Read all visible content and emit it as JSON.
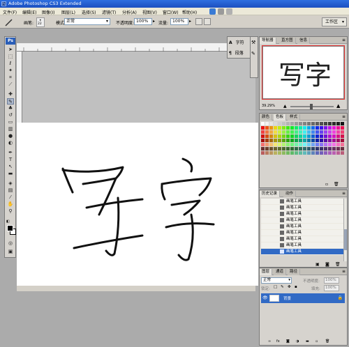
{
  "window": {
    "title": "Adobe Photoshop CS3 Extended",
    "app_icon": "Ps"
  },
  "menu": [
    "文件(F)",
    "编辑(E)",
    "图像(I)",
    "图层(L)",
    "选择(S)",
    "滤镜(T)",
    "分析(A)",
    "视图(V)",
    "窗口(W)",
    "帮助(H)"
  ],
  "options_bar": {
    "brush_label": "画笔:",
    "brush_size": "22",
    "mode_label": "模式:",
    "mode_value": "正常",
    "opacity_label": "不透明度:",
    "opacity_value": "100%",
    "flow_label": "流量:",
    "flow_value": "100%",
    "workspace_label": "工作区"
  },
  "toolbox": {
    "logo": "Ps"
  },
  "dock_collapsed": {
    "items": [
      "字符",
      "段落"
    ]
  },
  "navigator_panel": {
    "tabs": [
      "导航器",
      "直方图",
      "信息"
    ],
    "zoom": "39.29%",
    "thumb_text": "写字"
  },
  "color_panel": {
    "tabs": [
      "颜色",
      "色板",
      "样式"
    ]
  },
  "history_panel": {
    "tabs": [
      "历史记录",
      "动作"
    ],
    "items": [
      "画笔工具",
      "画笔工具",
      "画笔工具",
      "画笔工具",
      "画笔工具",
      "画笔工具",
      "画笔工具",
      "画笔工具",
      "画笔工具"
    ]
  },
  "layers_panel": {
    "tabs": [
      "图层",
      "通道",
      "路径"
    ],
    "blend_mode": "正常",
    "opacity_label": "不透明度:",
    "opacity_value": "100%",
    "lock_label": "锁定:",
    "fill_label": "填充:",
    "fill_value": "100%",
    "layer_name": "背景"
  },
  "colors": {
    "title_bar": "#1b4fc0",
    "selection": "#316ac5",
    "nav_frame": "#e03030"
  }
}
